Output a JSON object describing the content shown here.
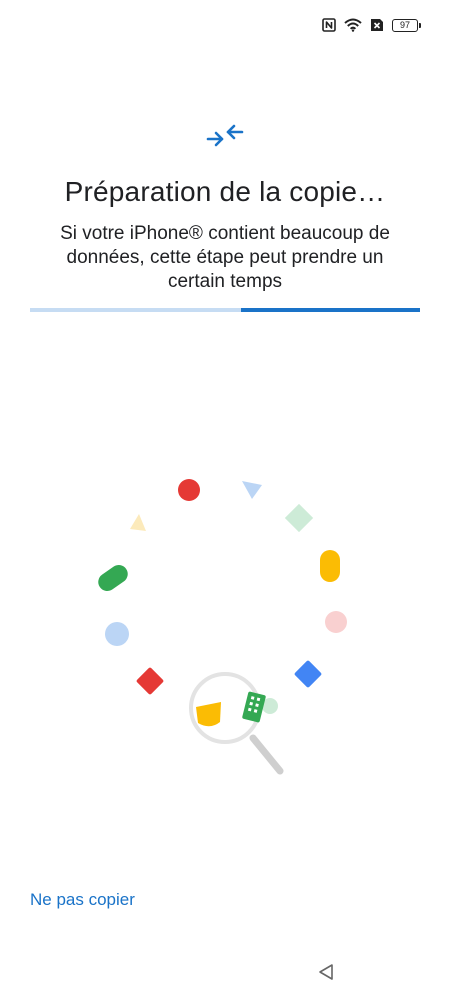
{
  "status_bar": {
    "icons": [
      "nfc-icon",
      "wifi-icon",
      "no-sim-icon",
      "battery-icon"
    ],
    "battery_level": "97"
  },
  "header": {
    "icon": "transfer-arrows-icon",
    "title": "Préparation de la copie…",
    "subtitle": "Si votre iPhone® contient beaucoup de données, cette étape peut prendre un certain temps"
  },
  "progress": {
    "fraction": 0.54,
    "track_color": "#c6dcf3",
    "fill_color": "#1a73c8"
  },
  "illustration": {
    "icon": "magnifier-icon",
    "shape_colors": [
      "#e53935",
      "#bbd5f5",
      "#cdebd7",
      "#fbbc04",
      "#f9d0d0",
      "#4285f4",
      "#e53935",
      "#bbd5f5",
      "#34a853",
      "#fceabb"
    ]
  },
  "footer": {
    "skip_label": "Ne pas copier"
  },
  "nav": {
    "back_icon": "back-triangle-icon"
  },
  "colors": {
    "accent": "#1a73c8"
  }
}
